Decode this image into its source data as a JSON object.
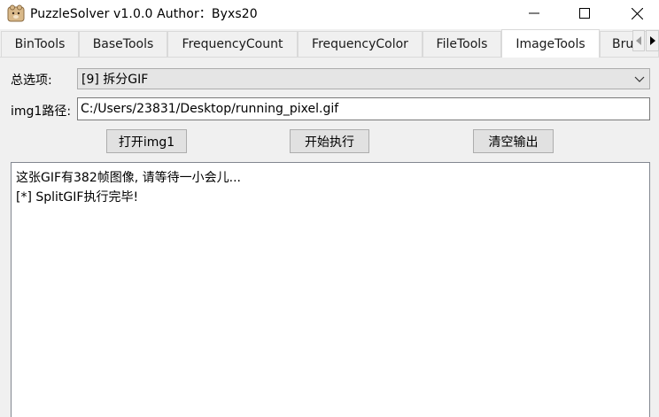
{
  "window": {
    "title": "PuzzleSolver v1.0.0  Author：Byxs20",
    "controls": [
      "minimize-icon",
      "maximize-icon",
      "close-icon"
    ]
  },
  "tabs": [
    {
      "label": "BinTools",
      "active": false
    },
    {
      "label": "BaseTools",
      "active": false
    },
    {
      "label": "FrequencyCount",
      "active": false
    },
    {
      "label": "FrequencyColor",
      "active": false
    },
    {
      "label": "FileTools",
      "active": false
    },
    {
      "label": "ImageTools",
      "active": true
    },
    {
      "label": "Bru",
      "active": false
    }
  ],
  "form": {
    "option_label": "总选项:",
    "option_value": "[9] 拆分GIF",
    "path_label": "img1路径:",
    "path_value": "C:/Users/23831/Desktop/running_pixel.gif"
  },
  "buttons": {
    "open_img1": "打开img1",
    "execute": "开始执行",
    "clear_output": "清空输出"
  },
  "output": {
    "lines": [
      "这张GIF有382帧图像, 请等待一小会儿...",
      "[*] SplitGIF执行完毕!"
    ]
  }
}
